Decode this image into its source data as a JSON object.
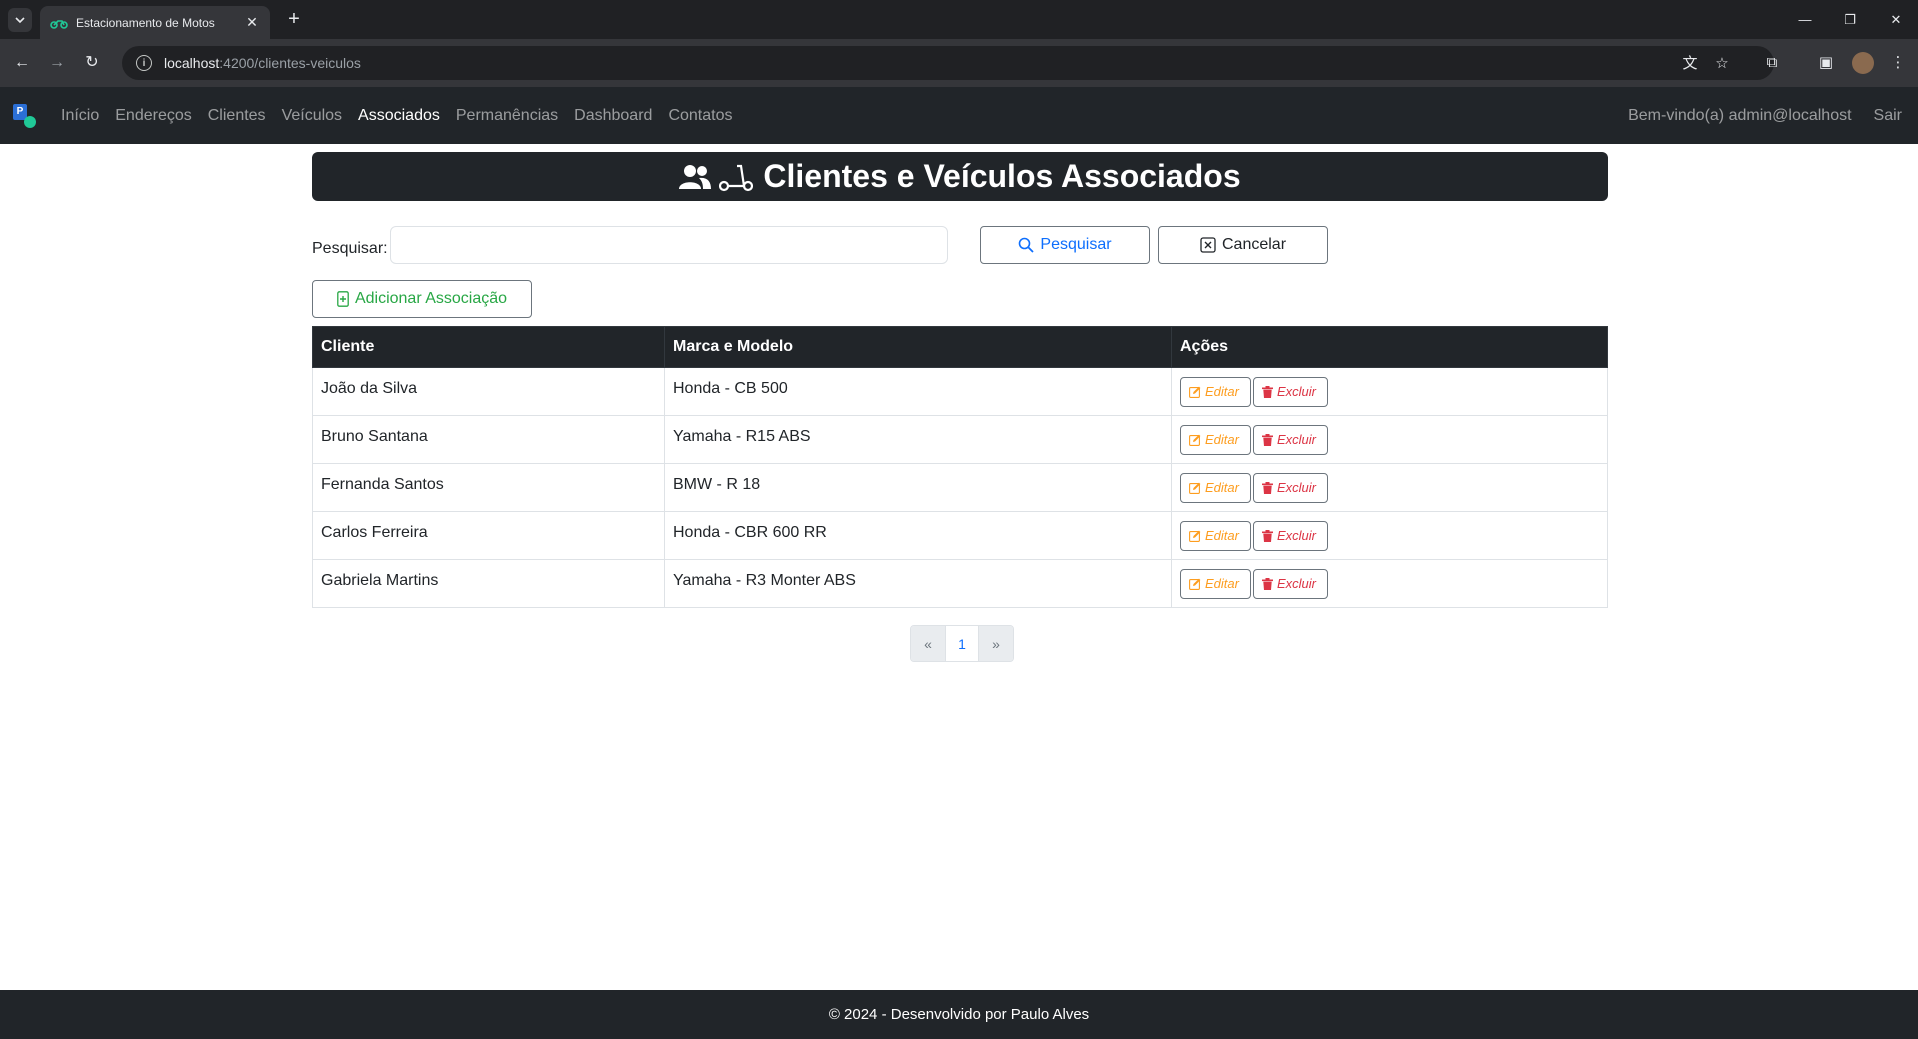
{
  "browser": {
    "tab_title": "Estacionamento de Motos",
    "url_host": "localhost",
    "url_path": ":4200/clientes-veiculos"
  },
  "nav": {
    "links": [
      {
        "label": "Início",
        "active": false
      },
      {
        "label": "Endereços",
        "active": false
      },
      {
        "label": "Clientes",
        "active": false
      },
      {
        "label": "Veículos",
        "active": false
      },
      {
        "label": "Associados",
        "active": true
      },
      {
        "label": "Permanências",
        "active": false
      },
      {
        "label": "Dashboard",
        "active": false
      },
      {
        "label": "Contatos",
        "active": false
      }
    ],
    "welcome": "Bem-vindo(a) admin@localhost",
    "logout": "Sair"
  },
  "page": {
    "title": "Clientes e Veículos Associados",
    "title_icons": [
      "users-icon",
      "scooter-icon"
    ]
  },
  "search": {
    "label": "Pesquisar:",
    "value": "",
    "search_button": "Pesquisar",
    "cancel_button": "Cancelar"
  },
  "add_button": "Adicionar Associação",
  "table": {
    "headers": [
      "Cliente",
      "Marca e Modelo",
      "Ações"
    ],
    "rows": [
      {
        "cliente": "João da Silva",
        "veiculo": "Honda - CB 500"
      },
      {
        "cliente": "Bruno Santana",
        "veiculo": "Yamaha - R15 ABS"
      },
      {
        "cliente": "Fernanda Santos",
        "veiculo": "BMW - R 18"
      },
      {
        "cliente": "Carlos Ferreira",
        "veiculo": "Honda - CBR 600 RR"
      },
      {
        "cliente": "Gabriela Martins",
        "veiculo": "Yamaha - R3 Monter ABS"
      }
    ],
    "edit_label": "Editar",
    "delete_label": "Excluir"
  },
  "pagination": {
    "prev": "«",
    "current": "1",
    "next": "»"
  },
  "footer": "© 2024 - Desenvolvido por Paulo Alves",
  "colors": {
    "dark": "#212529",
    "primary": "#0d6efd",
    "success": "#28a745",
    "warning": "#fd9d1f",
    "danger": "#dc3545"
  }
}
